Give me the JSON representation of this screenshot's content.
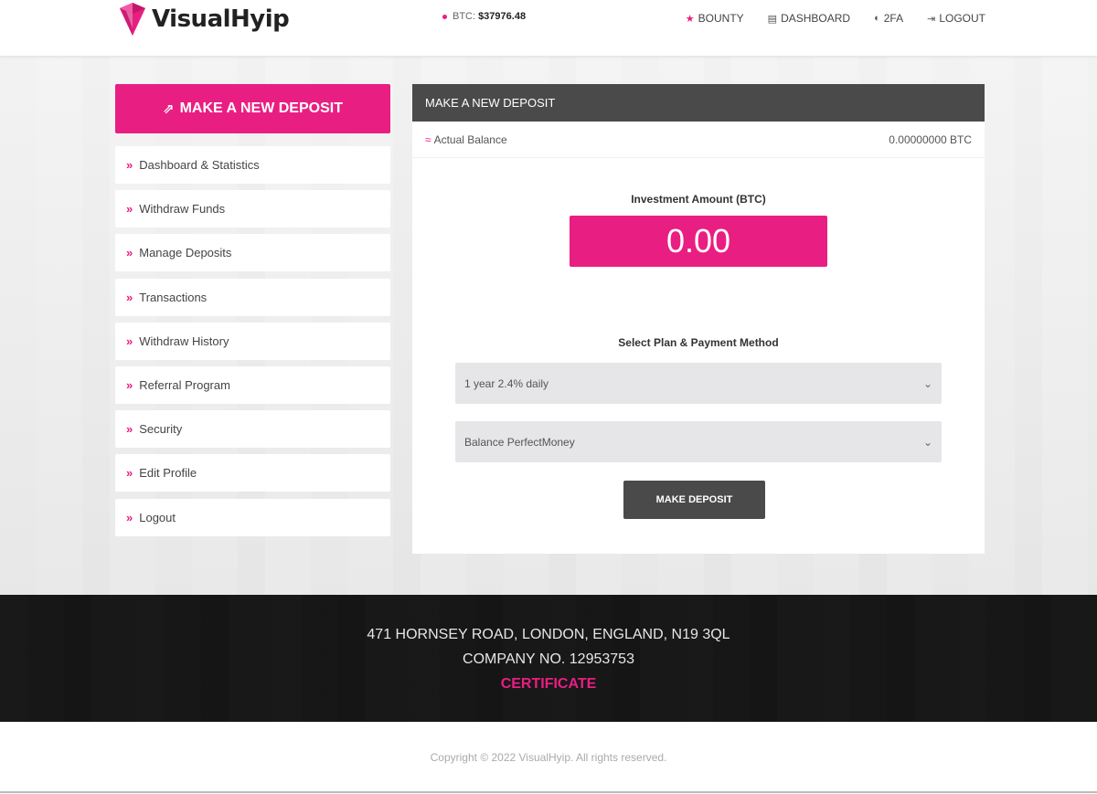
{
  "brand": {
    "name": "VisualHyip",
    "accent": "#e91e82"
  },
  "ticker": {
    "label": "BTC:",
    "value": "$37976.48"
  },
  "nav": {
    "bounty": "BOUNTY",
    "dashboard": "DASHBOARD",
    "twofa": "2FA",
    "logout": "LOGOUT"
  },
  "sidebar": {
    "deposit_button": "MAKE A NEW DEPOSIT",
    "items": [
      {
        "label": "Dashboard & Statistics"
      },
      {
        "label": "Withdraw Funds"
      },
      {
        "label": "Manage Deposits"
      },
      {
        "label": "Transactions"
      },
      {
        "label": "Withdraw History"
      },
      {
        "label": "Referral Program"
      },
      {
        "label": "Security"
      },
      {
        "label": "Edit Profile"
      },
      {
        "label": "Logout"
      }
    ]
  },
  "panel": {
    "title": "MAKE A NEW DEPOSIT",
    "balance_label": "Actual Balance",
    "balance_value": "0.00000000 BTC",
    "investment_label": "Investment Amount (BTC)",
    "amount": "0.00",
    "plan_label": "Select Plan & Payment Method",
    "plan_selected": "1 year 2.4% daily",
    "payment_selected": "Balance PerfectMoney",
    "submit": "MAKE DEPOSIT"
  },
  "footer": {
    "address": "471 HORNSEY ROAD, LONDON, ENGLAND, N19 3QL",
    "company": "COMPANY NO. 12953753",
    "certificate": "CERTIFICATE",
    "copyright": "Copyright © 2022 VisualHyip. All rights reserved."
  }
}
